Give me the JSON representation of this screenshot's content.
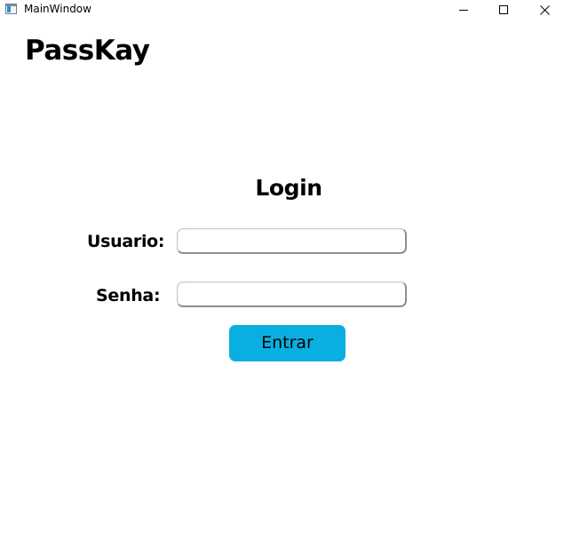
{
  "window": {
    "title": "MainWindow",
    "app_icon": "window-app-icon",
    "controls": {
      "minimize_icon": "minimize-icon",
      "maximize_icon": "maximize-icon",
      "close_icon": "close-icon"
    }
  },
  "app": {
    "title": "PassKay"
  },
  "login": {
    "heading": "Login",
    "username_label": "Usuario:",
    "username_value": "",
    "password_label": "Senha:",
    "password_value": "",
    "submit_label": "Entrar"
  },
  "colors": {
    "background": "#ffffff",
    "button": "#0aafe2",
    "text": "#000000"
  }
}
